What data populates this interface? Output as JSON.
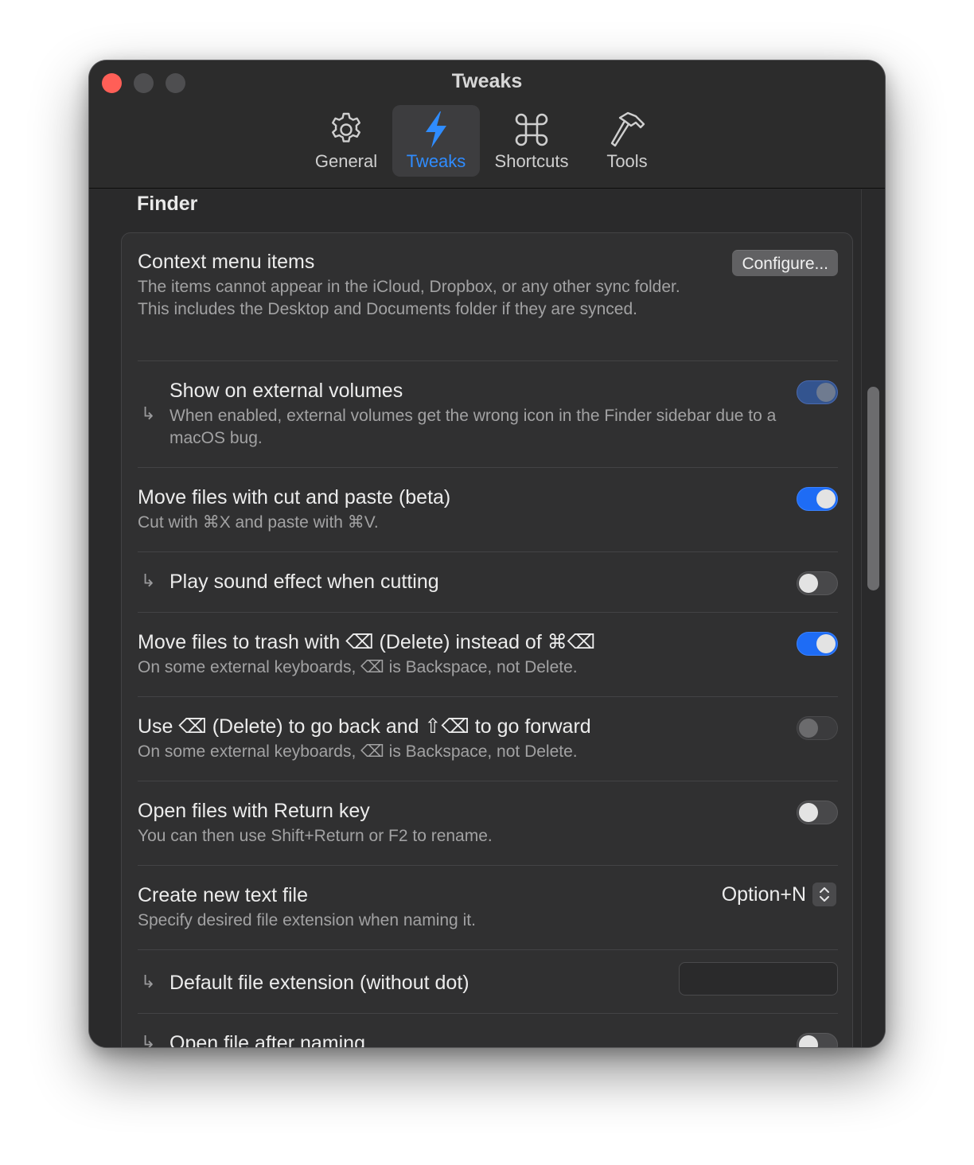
{
  "window": {
    "title": "Tweaks"
  },
  "toolbar": {
    "tabs": [
      {
        "label": "General",
        "icon": "gear-icon"
      },
      {
        "label": "Tweaks",
        "icon": "bolt-icon",
        "active": true
      },
      {
        "label": "Shortcuts",
        "icon": "command-icon"
      },
      {
        "label": "Tools",
        "icon": "hammer-icon"
      }
    ]
  },
  "section": {
    "title": "Finder"
  },
  "settings": {
    "context_menu": {
      "title": "Context menu items",
      "desc": "The items cannot appear in the iCloud, Dropbox, or any other sync folder. This includes the Desktop and Documents folder if they are synced.",
      "button": "Configure..."
    },
    "external_volumes": {
      "title": "Show on external volumes",
      "desc": "When enabled, external volumes get the wrong icon in the Finder sidebar due to a macOS bug.",
      "enabled": true
    },
    "cut_paste": {
      "title": "Move files with cut and paste (beta)",
      "desc": "Cut with ⌘X and paste with ⌘V.",
      "enabled": true
    },
    "sound_effect": {
      "title": "Play sound effect when cutting",
      "enabled": false
    },
    "trash_delete": {
      "title": "Move files to trash with ⌫ (Delete) instead of ⌘⌫",
      "desc": "On some external keyboards, ⌫ is Backspace, not Delete.",
      "enabled": true
    },
    "delete_back": {
      "title": "Use ⌫ (Delete) to go back and ⇧⌫ to go forward",
      "desc": "On some external keyboards, ⌫ is Backspace, not Delete.",
      "enabled": false
    },
    "return_open": {
      "title": "Open files with Return key",
      "desc": "You can then use Shift+Return or F2 to rename.",
      "enabled": false
    },
    "new_text_file": {
      "title": "Create new text file",
      "desc": "Specify desired file extension when naming it.",
      "shortcut": "Option+N"
    },
    "default_extension": {
      "title": "Default file extension (without dot)",
      "value": ""
    },
    "open_after_naming": {
      "title": "Open file after naming",
      "enabled": false
    }
  },
  "colors": {
    "accent": "#2f8cff",
    "toggle_on": "#1e6cf5",
    "close": "#ff5f57"
  }
}
